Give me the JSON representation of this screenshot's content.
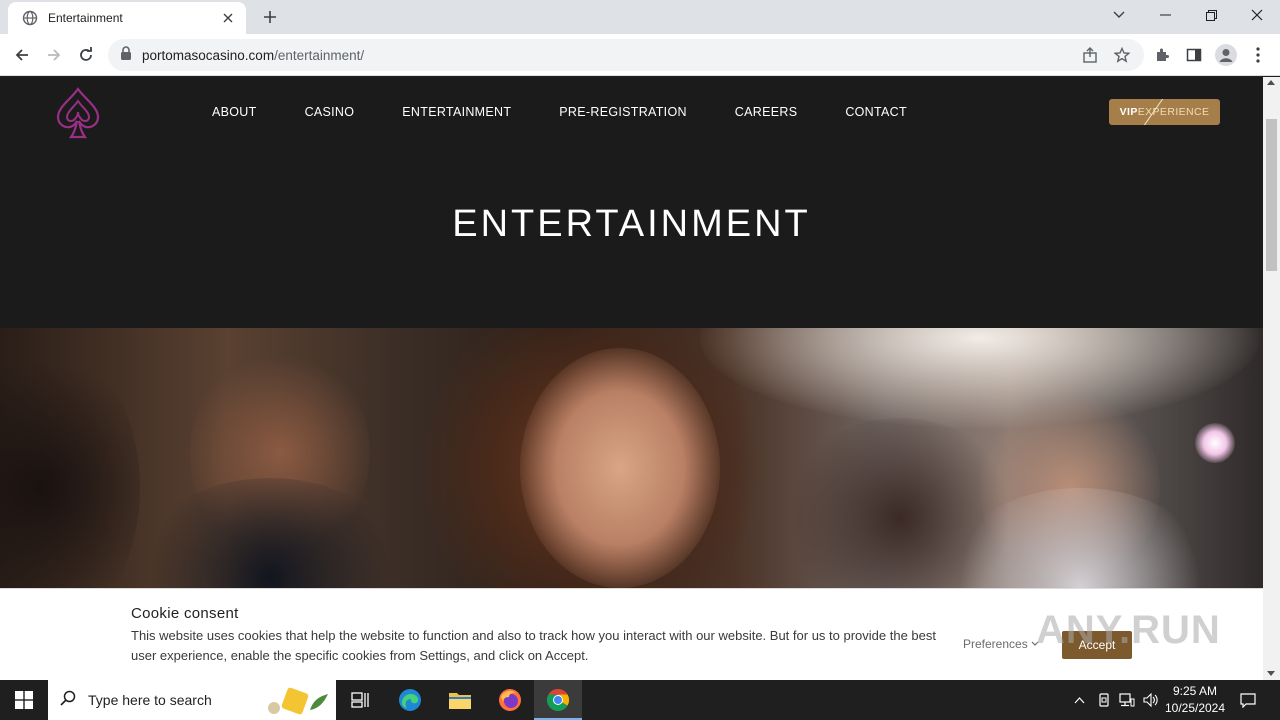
{
  "browser": {
    "tab_title": "Entertainment",
    "url_host": "portomasocasino.com",
    "url_path": "/entertainment/"
  },
  "site": {
    "nav": [
      "ABOUT",
      "CASINO",
      "ENTERTAINMENT",
      "PRE-REGISTRATION",
      "CAREERS",
      "CONTACT"
    ],
    "vip_bold": "VIP",
    "vip_rest": "EXPERIENCE",
    "hero_title": "ENTERTAINMENT"
  },
  "cookie": {
    "title": "Cookie consent",
    "text": "This website uses cookies that help the website to function and also to track how you interact with our website. But for us to provide the best user experience, enable the specific cookies from Settings, and click on Accept.",
    "preferences": "Preferences",
    "accept": "Accept"
  },
  "watermark": "ANY.RUN",
  "taskbar": {
    "search_placeholder": "Type here to search",
    "time": "9:25 AM",
    "date": "10/25/2024"
  },
  "colors": {
    "page_bg": "#1b1b1b",
    "logo": "#9a2f86",
    "vip_gold": "#a57e4a",
    "accept_brown": "#7c5a2e"
  }
}
